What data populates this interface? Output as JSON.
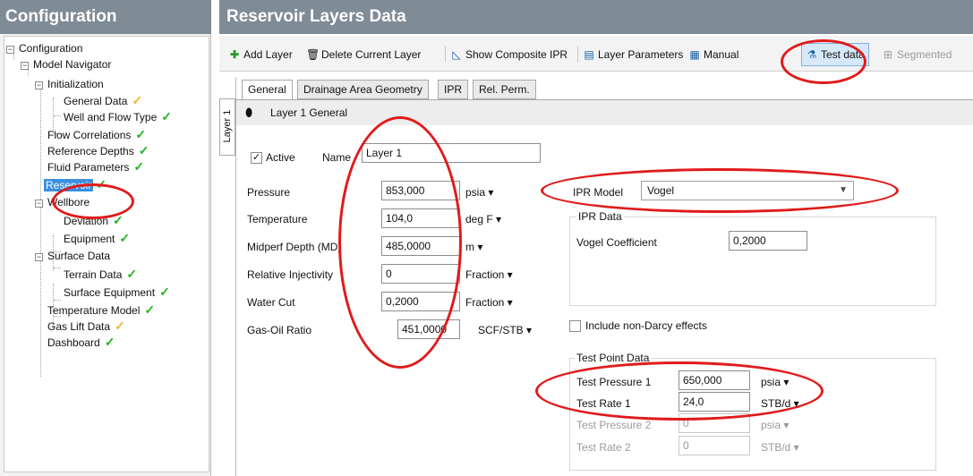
{
  "left_panel": {
    "title": "Configuration",
    "tree": {
      "root": "Configuration",
      "model_navigator": "Model Navigator",
      "initialization": "Initialization",
      "general_data": "General Data",
      "well_flow_type": "Well and Flow Type",
      "flow_correlations": "Flow Correlations",
      "reference_depths": "Reference Depths",
      "fluid_parameters": "Fluid Parameters",
      "reservoir": "Reservoir",
      "wellbore": "Wellbore",
      "deviation": "Deviation",
      "equipment": "Equipment",
      "surface_data": "Surface Data",
      "terrain_data": "Terrain Data",
      "surface_equipment": "Surface Equipment",
      "temperature_model": "Temperature Model",
      "gas_lift_data": "Gas Lift Data",
      "dashboard": "Dashboard"
    }
  },
  "right_panel": {
    "title": "Reservoir Layers Data",
    "toolbar": {
      "add_layer": "Add Layer",
      "delete_layer": "Delete Current Layer",
      "show_composite": "Show Composite IPR",
      "layer_parameters": "Layer Parameters",
      "manual": "Manual",
      "test_data": "Test data",
      "segmented": "Segmented"
    },
    "side_tab": "Layer 1",
    "tabs": [
      "General",
      "Drainage Area Geometry",
      "IPR",
      "Rel. Perm."
    ],
    "layer_header": "Layer 1 General",
    "active_label": "Active",
    "name_label": "Name",
    "name_value": "Layer 1",
    "fields": {
      "pressure": {
        "label": "Pressure",
        "value": "853,000",
        "unit": "psia ▾"
      },
      "temperature": {
        "label": "Temperature",
        "value": "104,0",
        "unit": "deg F ▾"
      },
      "midperf": {
        "label": "Midperf Depth (MD)",
        "value": "485,0000",
        "unit": "m ▾"
      },
      "rel_inj": {
        "label": "Relative Injectivity",
        "value": "0",
        "unit": "Fraction ▾"
      },
      "water_cut": {
        "label": "Water Cut",
        "value": "0,2000",
        "unit": "Fraction ▾"
      },
      "gor": {
        "label": "Gas-Oil Ratio",
        "value": "451,0000",
        "unit": "SCF/STB ▾"
      }
    },
    "ipr_model_label": "IPR Model",
    "ipr_model_value": "Vogel",
    "ipr_data_title": "IPR Data",
    "vogel_label": "Vogel Coefficient",
    "vogel_value": "0,2000",
    "non_darcy_label": "Include non-Darcy effects",
    "test_point_title": "Test Point Data",
    "test_points": {
      "tp1": {
        "label": "Test Pressure 1",
        "value": "650,000",
        "unit": "psia ▾"
      },
      "tr1": {
        "label": "Test Rate 1",
        "value": "24,0",
        "unit": "STB/d ▾"
      },
      "tp2": {
        "label": "Test Pressure 2",
        "value": "0",
        "unit": "psia ▾"
      },
      "tr2": {
        "label": "Test Rate 2",
        "value": "0",
        "unit": "STB/d ▾"
      }
    }
  },
  "colors": {
    "header": "#7f8b95",
    "selection": "#3a8fe0",
    "check_ok": "#1fb51f",
    "check_warn": "#f1b23a",
    "highlight_oval": "#e01b1b"
  }
}
